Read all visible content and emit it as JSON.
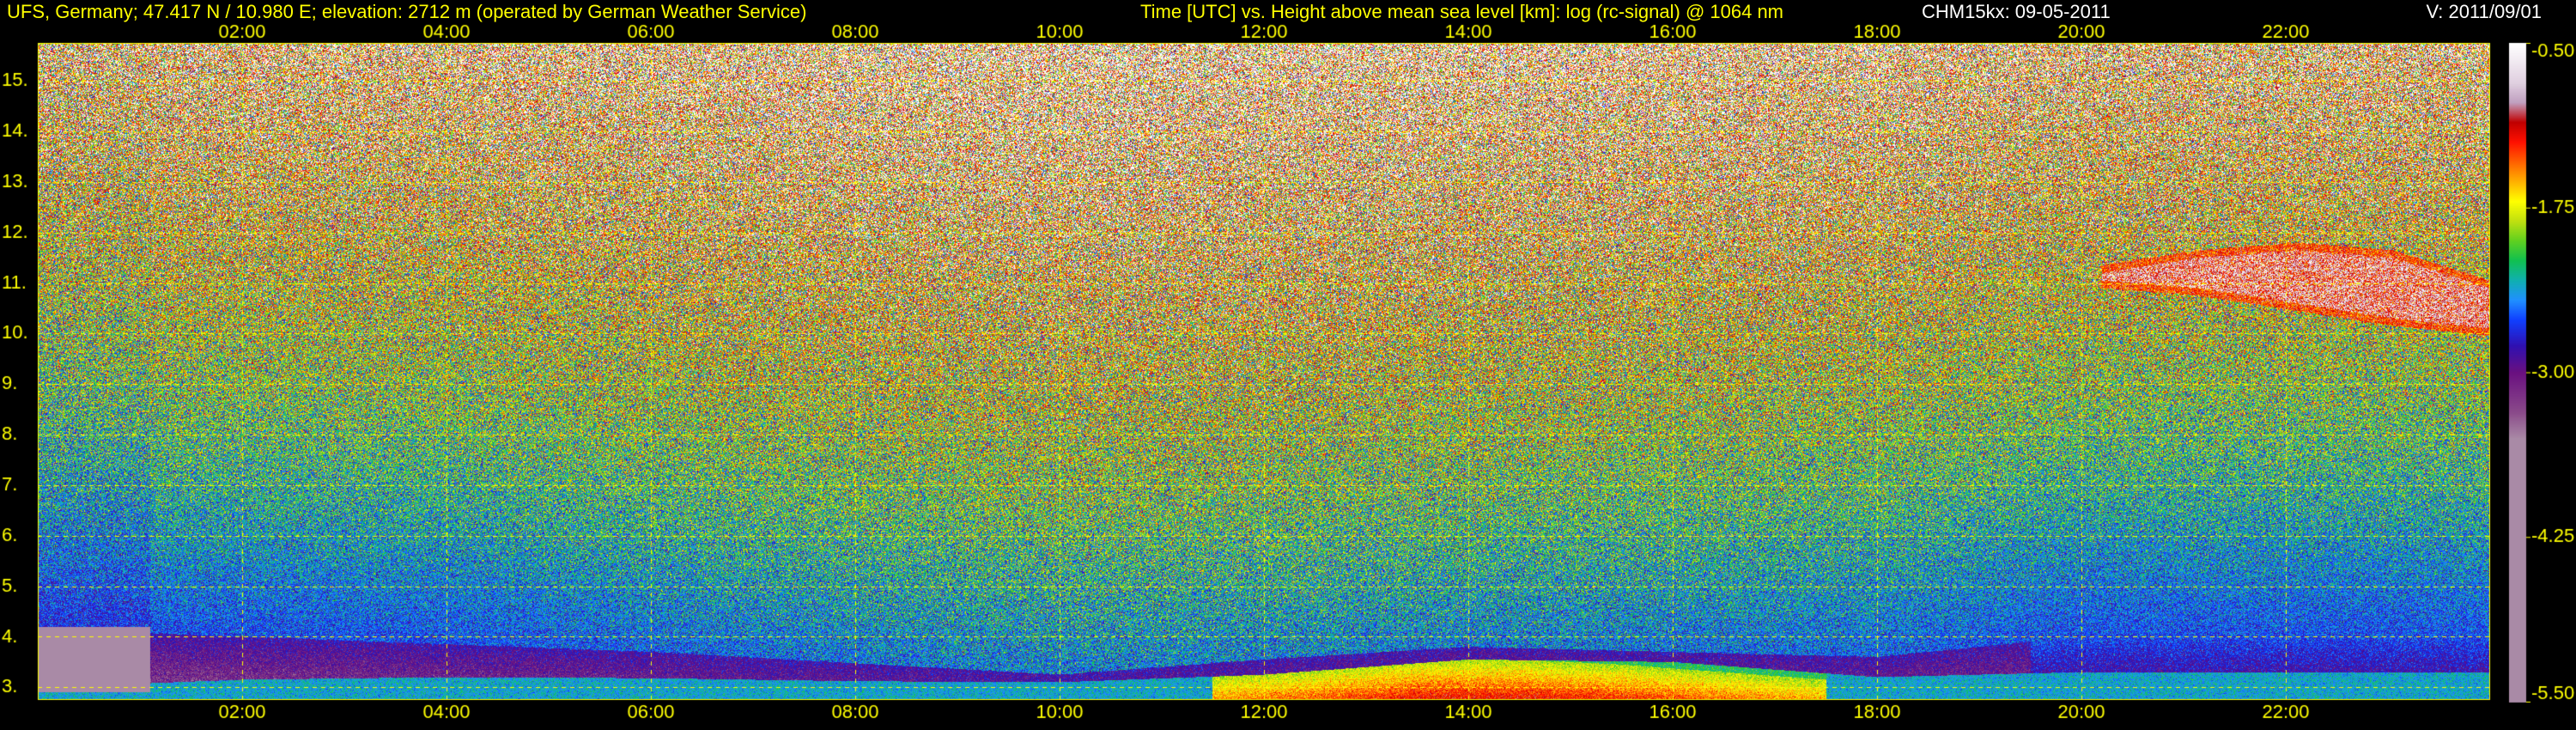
{
  "header": {
    "station": "UFS, Germany; 47.417 N / 10.980 E; elevation: 2712 m  (operated by German Weather Service)",
    "axes_description": "Time [UTC] vs. Height above mean sea level [km]: log (rc-signal) @ 1064 nm",
    "instrument": "CHM15kx: 09-05-2011",
    "version": "V: 2011/09/01"
  },
  "colors": {
    "background": "#000000",
    "text": "#ffff00",
    "grid": "#ffff00",
    "header_secondary": "#ffffff"
  },
  "chart_data": {
    "type": "heatmap",
    "title": "",
    "xlabel": "",
    "ylabel": "",
    "x_unit": "hours UTC",
    "xlim": [
      0,
      24
    ],
    "x_ticks": [
      2,
      4,
      6,
      8,
      10,
      12,
      14,
      16,
      18,
      20,
      22
    ],
    "x_tick_labels": [
      "02:00",
      "04:00",
      "06:00",
      "08:00",
      "10:00",
      "12:00",
      "14:00",
      "16:00",
      "18:00",
      "20:00",
      "22:00"
    ],
    "y_unit": "km",
    "ylim": [
      2.75,
      15.75
    ],
    "y_ticks": [
      3,
      4,
      5,
      6,
      7,
      8,
      9,
      10,
      11,
      12,
      13,
      14,
      15
    ],
    "y_tick_labels": [
      "3.",
      "4.",
      "5.",
      "6.",
      "7.",
      "8.",
      "9.",
      "10.",
      "11.",
      "12.",
      "13.",
      "14.",
      "15."
    ],
    "grid": true,
    "colorbar": {
      "position": "right",
      "range": [
        -5.5,
        -0.5
      ],
      "ticks": [
        -0.5,
        -1.75,
        -3.0,
        -4.25,
        -5.5
      ],
      "tick_labels": [
        "-0.50",
        "-1.75",
        "-3.00",
        "-4.25",
        "-5.50"
      ],
      "colors": [
        {
          "value": -5.5,
          "color": "#a98aa6"
        },
        {
          "value": -3.5,
          "color": "#a98aa6"
        },
        {
          "value": -3.3,
          "color": "#8a4a8a"
        },
        {
          "value": -3.0,
          "color": "#6a1080"
        },
        {
          "value": -2.8,
          "color": "#3010b0"
        },
        {
          "value": -2.6,
          "color": "#1040ff"
        },
        {
          "value": -2.45,
          "color": "#2090ff"
        },
        {
          "value": -2.3,
          "color": "#10b0b0"
        },
        {
          "value": -2.15,
          "color": "#10c050"
        },
        {
          "value": -2.0,
          "color": "#60d020"
        },
        {
          "value": -1.85,
          "color": "#c0e010"
        },
        {
          "value": -1.7,
          "color": "#ffff00"
        },
        {
          "value": -1.55,
          "color": "#ffb000"
        },
        {
          "value": -1.4,
          "color": "#ff6000"
        },
        {
          "value": -1.25,
          "color": "#ff1000"
        },
        {
          "value": -1.1,
          "color": "#c00000"
        },
        {
          "value": -0.95,
          "color": "#c0a0c0"
        },
        {
          "value": -0.8,
          "color": "#e0d0e0"
        },
        {
          "value": -0.5,
          "color": "#ffffff"
        }
      ]
    },
    "features": [
      {
        "name": "boundary layer",
        "x": [
          0.7,
          6,
          10,
          12,
          14,
          16,
          18,
          20,
          24
        ],
        "y_top": [
          4.1,
          3.7,
          3.25,
          3.55,
          3.8,
          3.7,
          3.6,
          4.0,
          4.0
        ],
        "value": -2.85
      },
      {
        "name": "surface layer",
        "x": [
          0.7,
          2,
          4,
          6,
          8,
          10,
          12,
          14,
          16,
          18,
          20,
          22,
          24
        ],
        "y_top": [
          3.05,
          3.15,
          3.2,
          3.18,
          3.12,
          3.1,
          3.25,
          3.55,
          3.5,
          3.2,
          3.3,
          3.3,
          3.3
        ],
        "value": -2.35
      },
      {
        "name": "midday aerosol",
        "x": [
          11.5,
          12.5,
          13.5,
          14.5,
          15.5,
          16.5,
          17.5
        ],
        "y_top": [
          3.2,
          3.35,
          3.55,
          3.55,
          3.45,
          3.3,
          3.15
        ],
        "value": -1.9
      },
      {
        "name": "cirrus cloud",
        "x_start": 20.2,
        "x_end": 24,
        "y_upper": [
          11.2,
          11.5,
          11.65,
          11.5,
          10.9
        ],
        "y_lower": [
          11.05,
          10.9,
          10.6,
          10.3,
          10.1
        ],
        "value": -0.6
      },
      {
        "name": "noise region",
        "x_start": 0,
        "x_end": 1.1,
        "y_bottom": 2.9,
        "y_top": 4.2,
        "value": -4.5
      }
    ]
  }
}
